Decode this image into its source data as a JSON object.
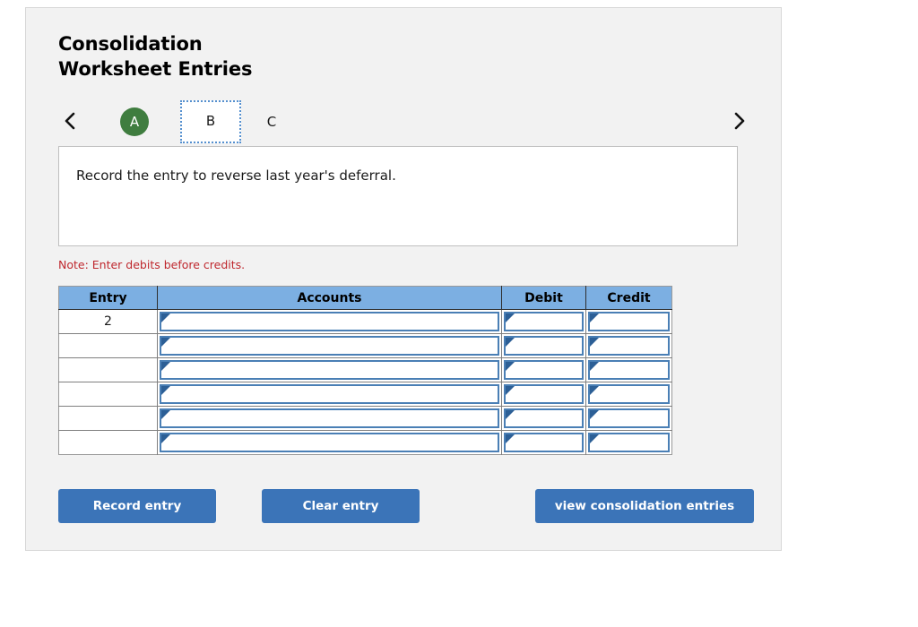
{
  "page": {
    "title_lines": [
      "Consolidation",
      "Worksheet Entries"
    ]
  },
  "tabs": {
    "prev_icon": "chevron-left-icon",
    "next_icon": "chevron-right-icon",
    "items": [
      {
        "label": "A",
        "state": "completed",
        "style": "green-circle"
      },
      {
        "label": "B",
        "state": "selected",
        "style": "white-box-dotted"
      },
      {
        "label": "C",
        "state": "default",
        "style": "plain"
      }
    ],
    "accent_green": "#3f7d3f",
    "focus_border": "#5590cf"
  },
  "prompt": {
    "text": "Record the entry to reverse last year's deferral."
  },
  "note": {
    "text": "Note: Enter debits before credits.",
    "color": "#bf272d"
  },
  "table": {
    "header_color": "#7cafe2",
    "cell_border_color": "#4a7fb5",
    "columns": [
      "Entry",
      "Accounts",
      "Debit",
      "Credit"
    ],
    "rows": [
      {
        "entry": "2",
        "accounts": "",
        "debit": "",
        "credit": ""
      },
      {
        "entry": "",
        "accounts": "",
        "debit": "",
        "credit": ""
      },
      {
        "entry": "",
        "accounts": "",
        "debit": "",
        "credit": ""
      },
      {
        "entry": "",
        "accounts": "",
        "debit": "",
        "credit": ""
      },
      {
        "entry": "",
        "accounts": "",
        "debit": "",
        "credit": ""
      },
      {
        "entry": "",
        "accounts": "",
        "debit": "",
        "credit": ""
      }
    ]
  },
  "buttons": {
    "record": "Record entry",
    "clear": "Clear entry",
    "view": "view consolidation entries",
    "color": "#3b74b8"
  }
}
